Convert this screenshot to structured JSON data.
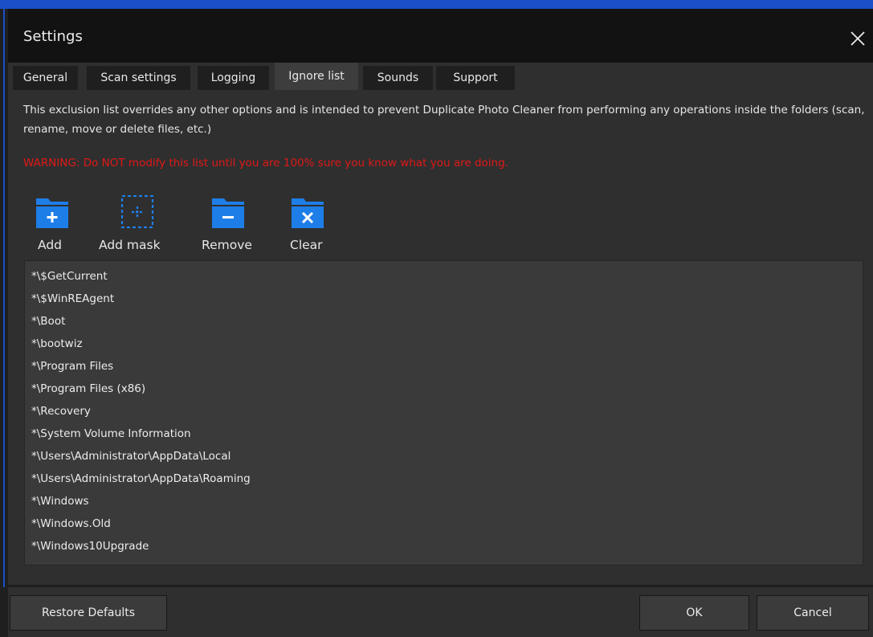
{
  "window": {
    "title": "Settings",
    "close_icon": "close-icon"
  },
  "tabs": [
    {
      "label": "General",
      "active": false
    },
    {
      "label": "Scan settings",
      "active": false
    },
    {
      "label": "Logging",
      "active": false
    },
    {
      "label": "Ignore list",
      "active": true
    },
    {
      "label": "Sounds",
      "active": false
    },
    {
      "label": "Support",
      "active": false
    }
  ],
  "ignore_list": {
    "description": "This exclusion list overrides any other options and is intended to prevent Duplicate Photo Cleaner from performing any operations inside the folders (scan, rename, move or delete files, etc.)",
    "warning": "WARNING: Do NOT modify this list until you are 100% sure you know what you are doing.",
    "warning_color": "#e01818",
    "toolbar": [
      {
        "label": "Add",
        "icon": "folder-add-icon"
      },
      {
        "label": "Add mask",
        "icon": "folder-add-mask-icon"
      },
      {
        "label": "Remove",
        "icon": "folder-remove-icon"
      },
      {
        "label": "Clear",
        "icon": "folder-clear-icon"
      }
    ],
    "items": [
      "*\\$GetCurrent",
      "*\\$WinREAgent",
      "*\\Boot",
      "*\\bootwiz",
      "*\\Program Files",
      "*\\Program Files (x86)",
      "*\\Recovery",
      "*\\System Volume Information",
      "*\\Users\\Administrator\\AppData\\Local",
      "*\\Users\\Administrator\\AppData\\Roaming",
      "*\\Windows",
      "*\\Windows.Old",
      "*\\Windows10Upgrade"
    ]
  },
  "footer": {
    "restore_defaults_label": "Restore Defaults",
    "ok_label": "OK",
    "cancel_label": "Cancel"
  },
  "colors": {
    "accent_blue": "#1a4fc7",
    "folder_icon_blue": "#1e7ee8",
    "background": "#2f2f2f",
    "titlebar": "#121212"
  }
}
